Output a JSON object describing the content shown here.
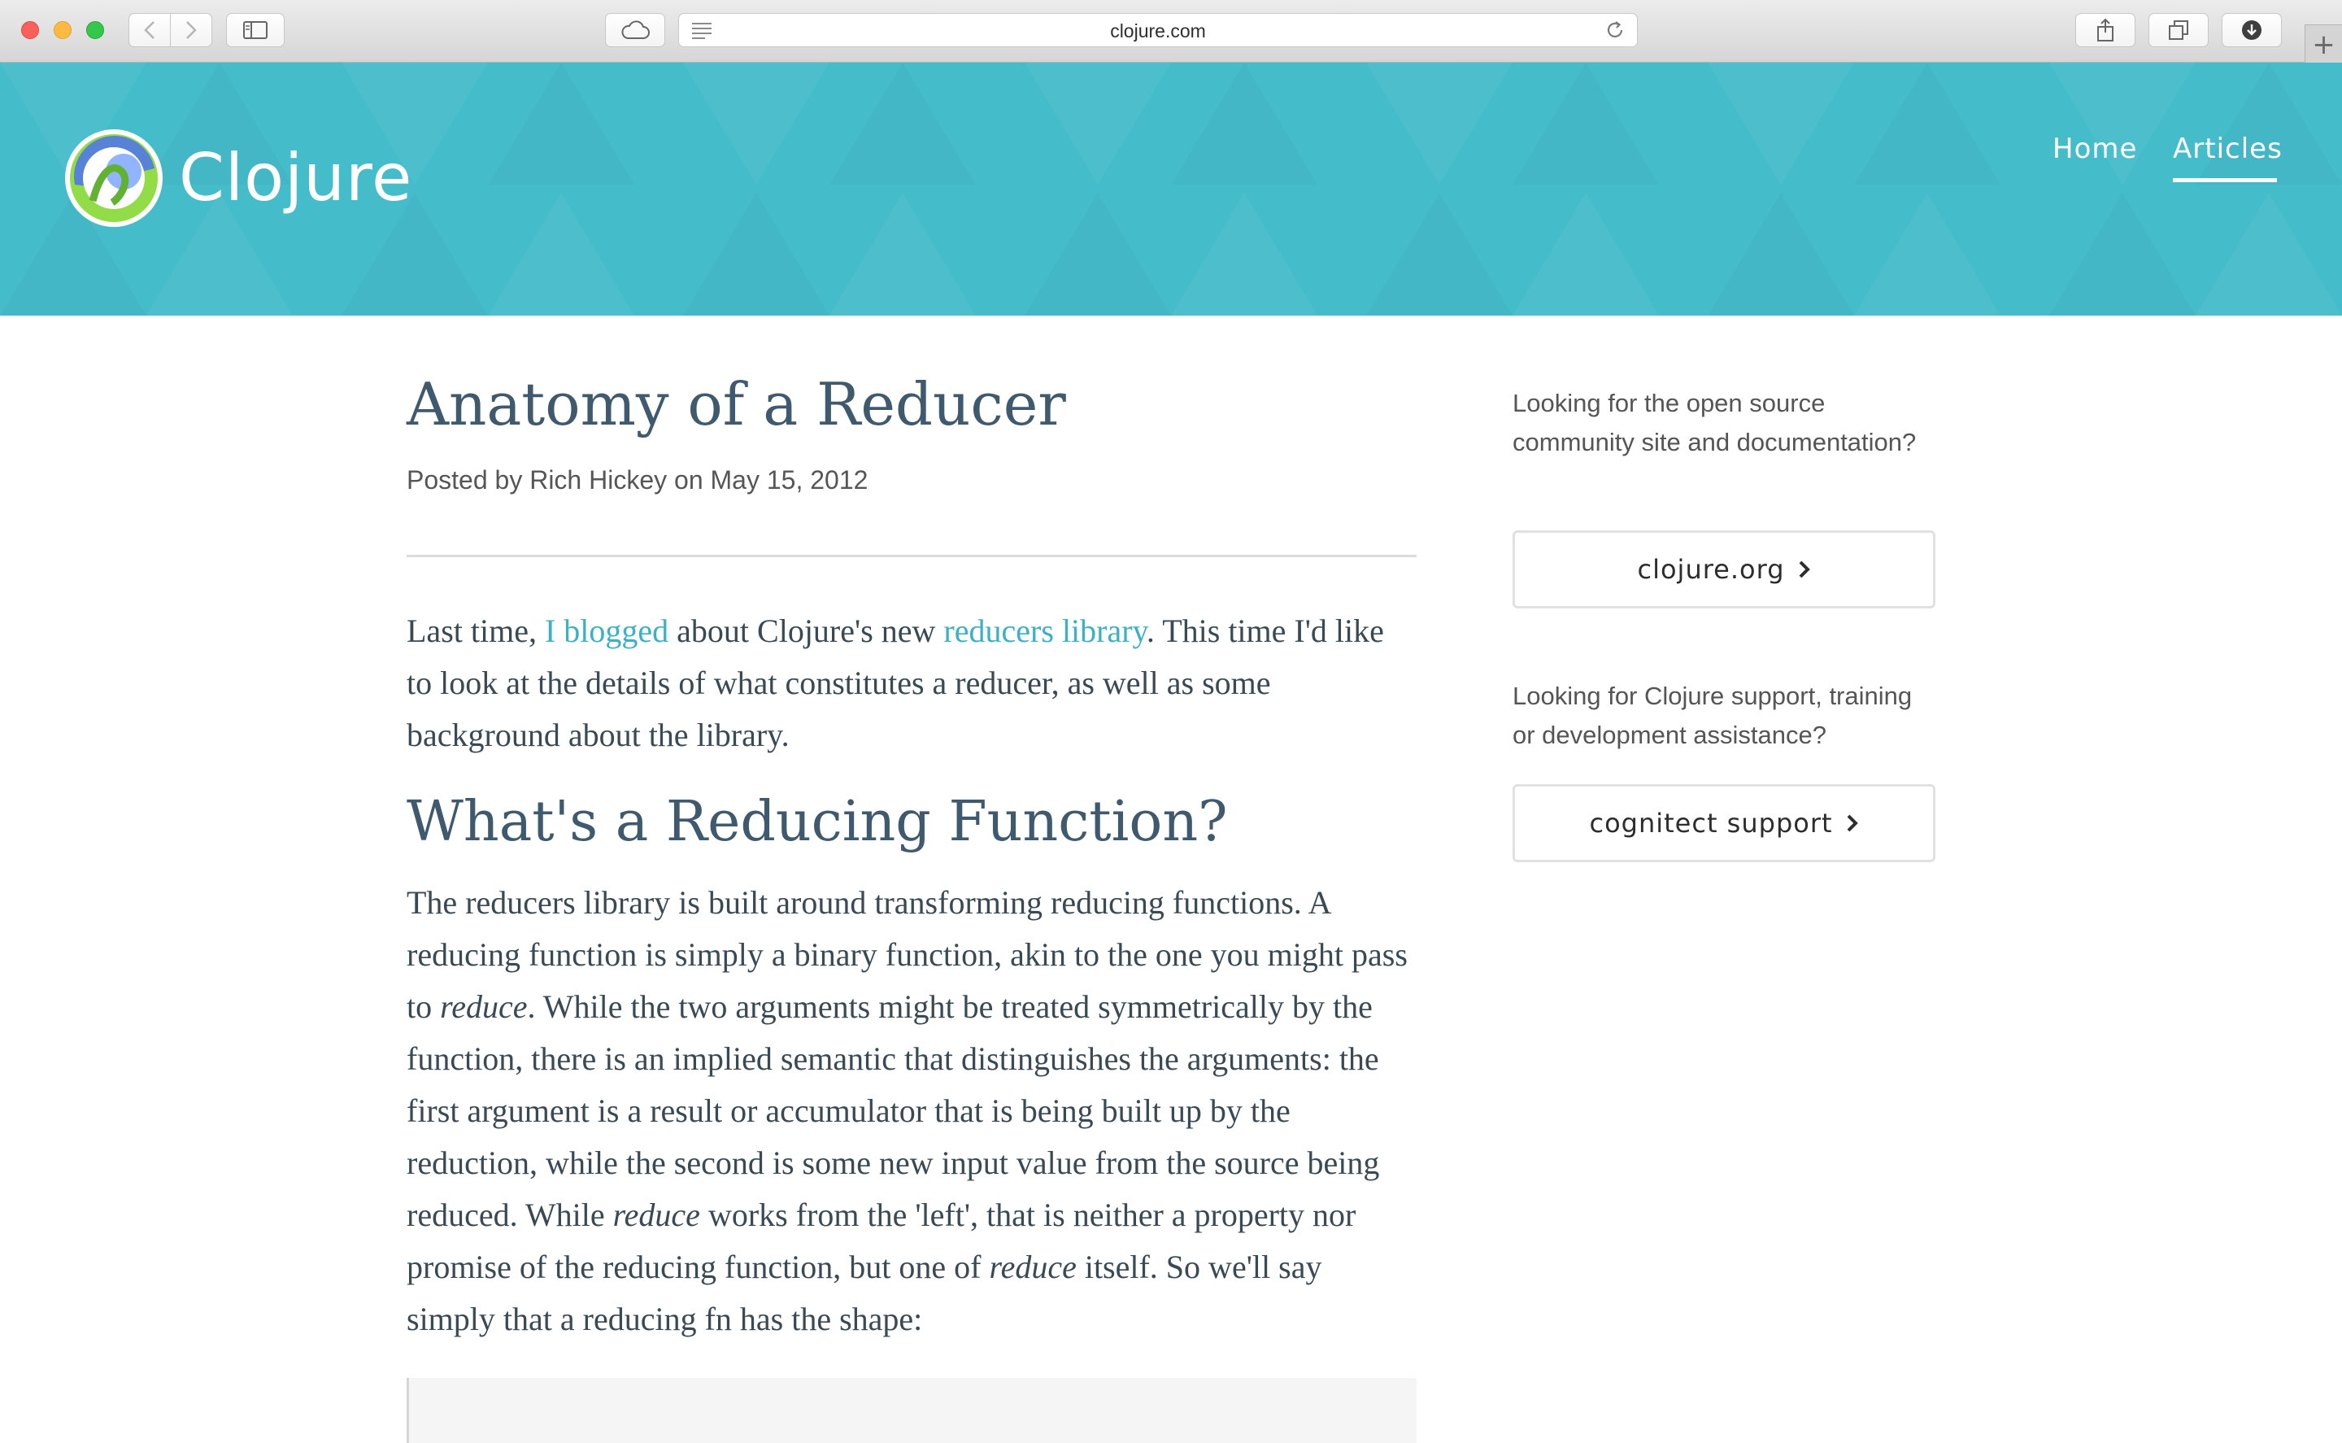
{
  "browser": {
    "url": "clojure.com",
    "icons": [
      "back-icon",
      "forward-icon",
      "sidebar-icon",
      "icloud-tabs-icon",
      "reader-icon",
      "reload-icon",
      "share-icon",
      "tabs-icon",
      "downloads-icon",
      "new-tab-icon"
    ],
    "colors": {
      "close": "#fc605c",
      "minimize": "#fcbb40",
      "zoom": "#34c84a"
    }
  },
  "header": {
    "brand": "Clojure",
    "bg_color": "#45bcca",
    "nav": {
      "home": "Home",
      "articles": "Articles",
      "active": "Articles"
    }
  },
  "article": {
    "title": "Anatomy of a Reducer",
    "byline": "Posted by Rich Hickey on May 15, 2012",
    "p1": {
      "t1": "Last time, ",
      "link1": "I blogged",
      "t2": " about Clojure's new ",
      "link2": "reducers library",
      "t3": ". This time I'd like to look at the details of what constitutes a reducer, as well as some background about the library."
    },
    "section_title": "What's a Reducing Function?",
    "p2": {
      "t1": "The reducers library is built around transforming reducing functions. A reducing function is simply a binary function, akin to the one you might pass to ",
      "em1": "reduce",
      "t2": ". While the two arguments might be treated symmetrically by the function, there is an implied semantic that distinguishes the arguments: the first argument is a result or accumulator that is being built up by the reduction, while the second is some new input value from the source being reduced. While ",
      "em2": "reduce",
      "t3": " works from the 'left', that is neither a property nor promise of the reducing function, but one of ",
      "em3": "reduce",
      "t4": " itself. So we'll say simply that a reducing fn has the shape:"
    },
    "link_color": "#3bb1c3"
  },
  "sidebar": {
    "open_source_text": "Looking for the open source community site and documentation?",
    "open_source_button": "clojure.org",
    "support_text": "Looking for Clojure support, training or development assistance?",
    "support_button": "cognitect support"
  }
}
